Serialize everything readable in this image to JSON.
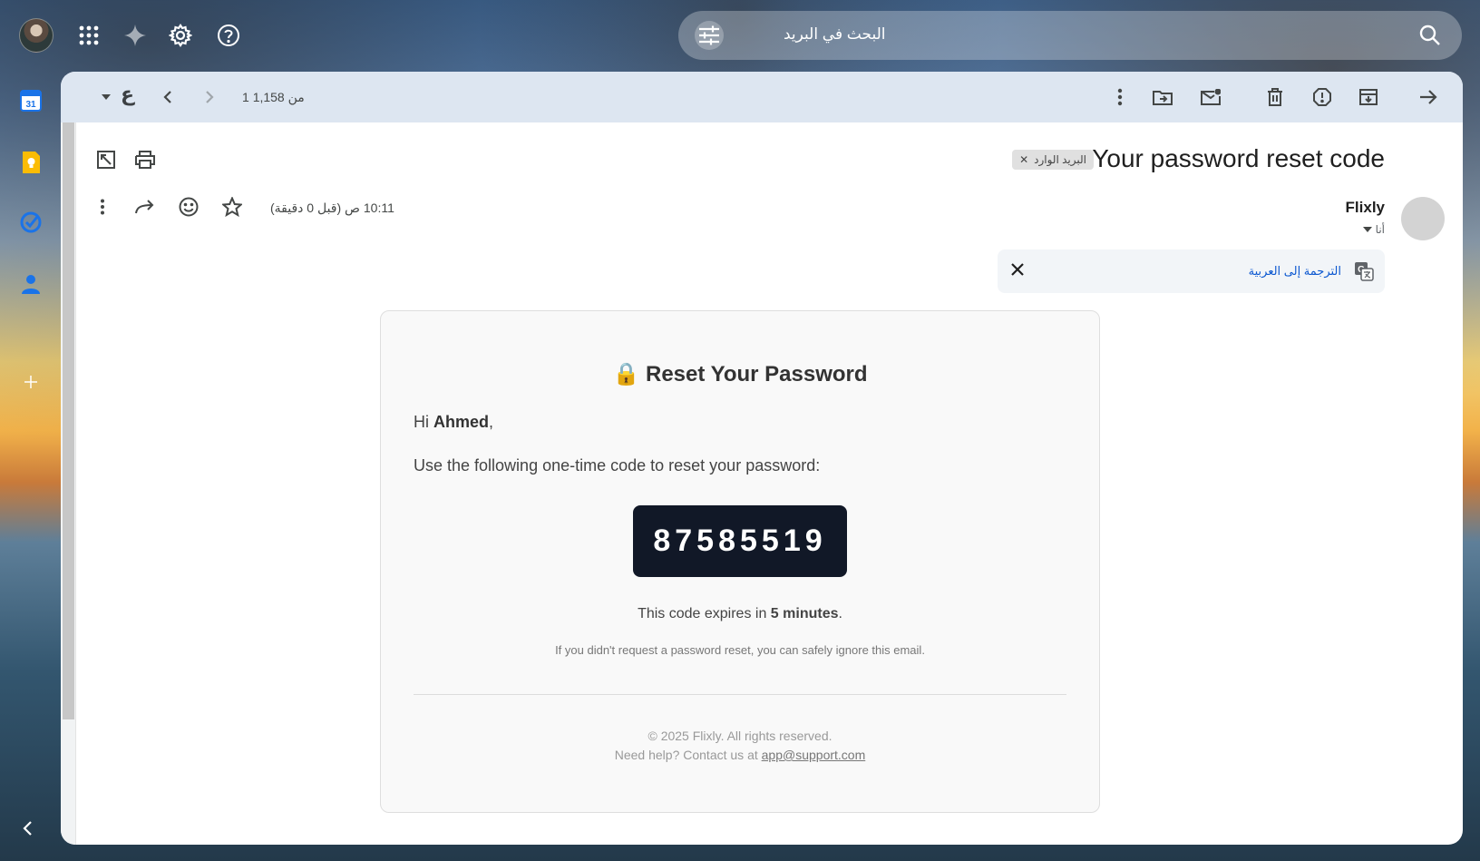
{
  "search": {
    "placeholder": "البحث في البريد"
  },
  "toolbar": {
    "pager": "1 من 1,158",
    "input_tool": "ع"
  },
  "message": {
    "subject": "Your password reset code",
    "label": "البريد الوارد",
    "sender": "Flixly",
    "recipient": "أنا",
    "time": "10:11 ص (قبل 0 دقيقة)",
    "translate_link": "الترجمة إلى العربية"
  },
  "email": {
    "heading": "Reset Your Password",
    "heading_emoji": "🔒",
    "greeting_prefix": "Hi ",
    "greeting_name": "Ahmed",
    "greeting_suffix": ",",
    "instruction": "Use the following one-time code to reset your password:",
    "code": "87585519",
    "expires_prefix": "This code expires in ",
    "expires_value": "5 minutes",
    "expires_suffix": ".",
    "ignore_note": "If you didn't request a password reset, you can safely ignore this email.",
    "copyright": "© 2025 Flixly. All rights reserved.",
    "help_prefix": "Need help? Contact us at ",
    "help_email": "app@support.com"
  },
  "colors": {
    "accent": "#0b57d0",
    "code_bg": "#111827",
    "calendar": "#1a73e8",
    "keep": "#fbbc04",
    "tasks": "#1a73e8",
    "contacts": "#1a73e8"
  },
  "calendar_day": "31"
}
